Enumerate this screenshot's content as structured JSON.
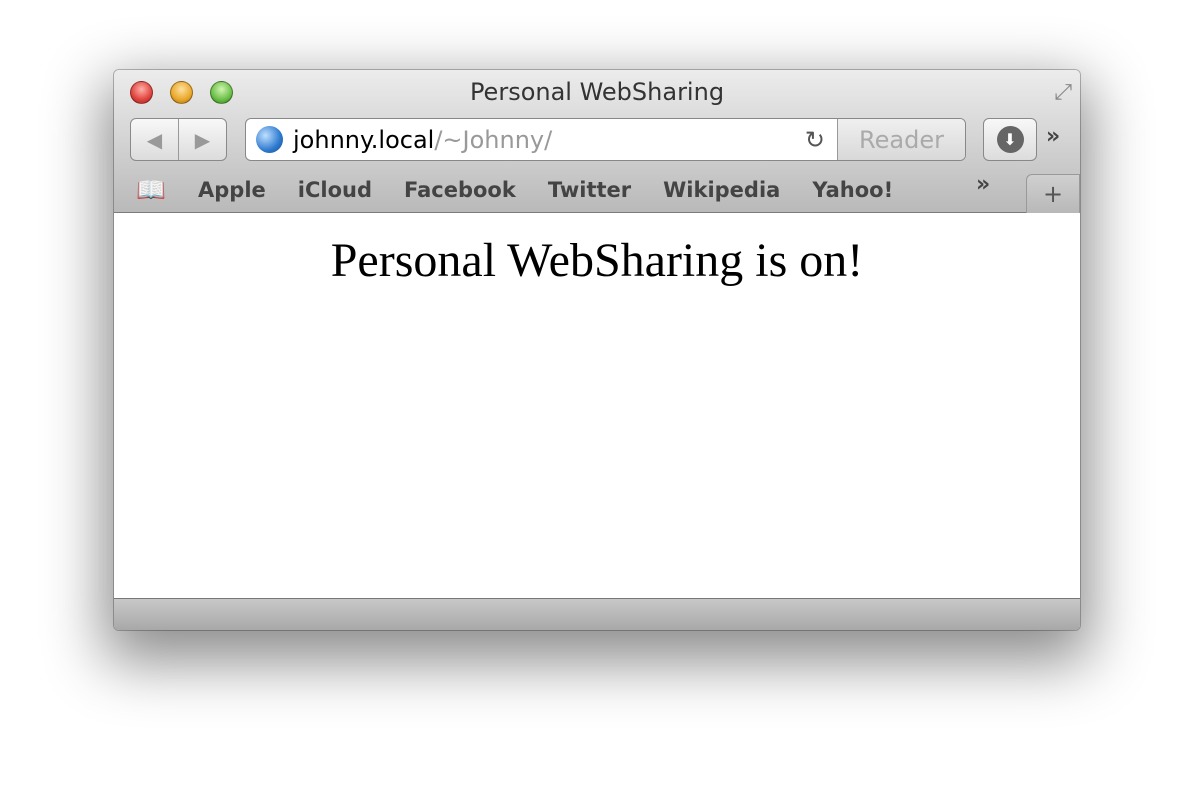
{
  "window": {
    "title": "Personal WebSharing"
  },
  "toolbar": {
    "back_icon": "◀",
    "forward_icon": "▶",
    "url_host": "johnny.local",
    "url_path": "/~Johnny/",
    "reader_label": "Reader",
    "reload_icon": "↻",
    "download_icon": "⬇",
    "overflow_icon": "»"
  },
  "bookmarks": {
    "items": [
      "Apple",
      "iCloud",
      "Facebook",
      "Twitter",
      "Wikipedia",
      "Yahoo!"
    ],
    "overflow_icon": "»",
    "new_tab_icon": "+"
  },
  "content": {
    "heading": "Personal WebSharing is on!"
  },
  "colors": {
    "close": "#e0443e",
    "minimize": "#e9a82a",
    "zoom": "#6cbf48"
  }
}
